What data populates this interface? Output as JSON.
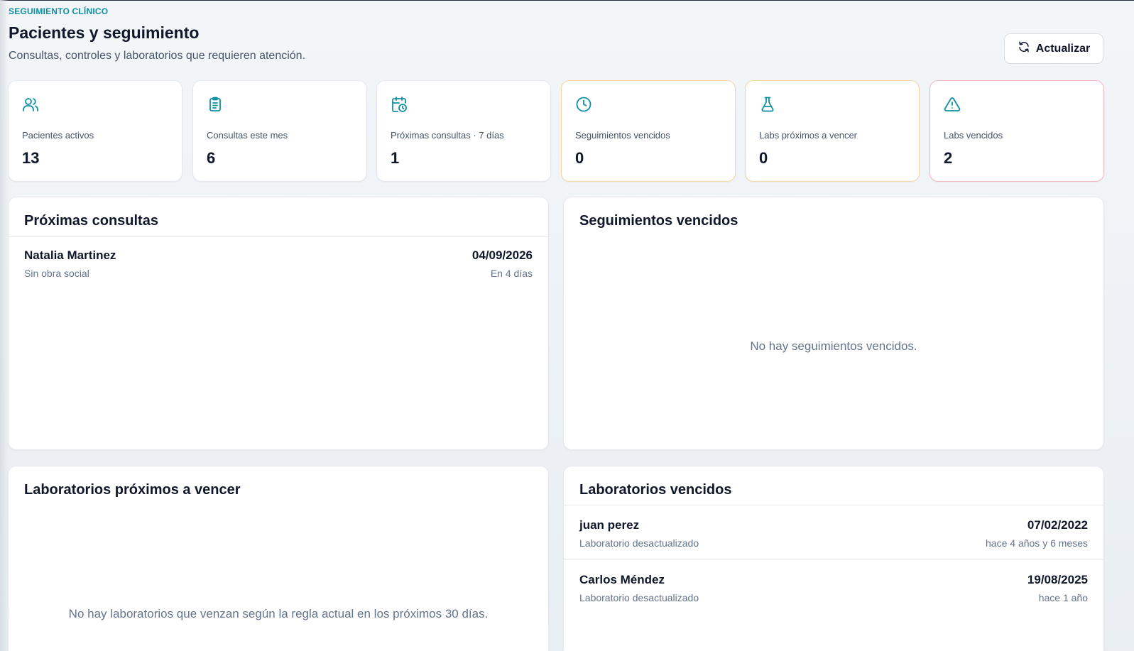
{
  "header": {
    "eyebrow": "SEGUIMIENTO CLÍNICO",
    "title": "Pacientes y seguimiento",
    "subtitle": "Consultas, controles y laboratorios que requieren atención.",
    "refresh_label": "Actualizar"
  },
  "stats": [
    {
      "label": "Pacientes activos",
      "value": "13",
      "icon": "users-icon"
    },
    {
      "label": "Consultas este mes",
      "value": "6",
      "icon": "clipboard-icon"
    },
    {
      "label": "Próximas consultas · 7 días",
      "value": "1",
      "icon": "calendar-clock-icon"
    },
    {
      "label": "Seguimientos vencidos",
      "value": "0",
      "icon": "clock-icon"
    },
    {
      "label": "Labs próximos a vencer",
      "value": "0",
      "icon": "flask-icon"
    },
    {
      "label": "Labs vencidos",
      "value": "2",
      "icon": "alert-triangle-icon"
    }
  ],
  "panels": {
    "upcoming": {
      "title": "Próximas consultas",
      "items": [
        {
          "name": "Natalia Martinez",
          "sub": "Sin obra social",
          "date": "04/09/2026",
          "relative": "En 4 días"
        }
      ]
    },
    "overdue_followups": {
      "title": "Seguimientos vencidos",
      "empty": "No hay seguimientos vencidos."
    },
    "labs_upcoming": {
      "title": "Laboratorios próximos a vencer",
      "empty": "No hay laboratorios que venzan según la regla actual en los próximos 30 días."
    },
    "labs_overdue": {
      "title": "Laboratorios vencidos",
      "items": [
        {
          "name": "juan perez",
          "sub": "Laboratorio desactualizado",
          "date": "07/02/2022",
          "relative": "hace 4 años y 6 meses"
        },
        {
          "name": "Carlos Méndez",
          "sub": "Laboratorio desactualizado",
          "date": "19/08/2025",
          "relative": "hace 1 año"
        }
      ]
    }
  },
  "colors": {
    "accent": "#0e8fa3",
    "warn_border": "#f5d6a4",
    "danger_border": "#f2b8bd"
  }
}
